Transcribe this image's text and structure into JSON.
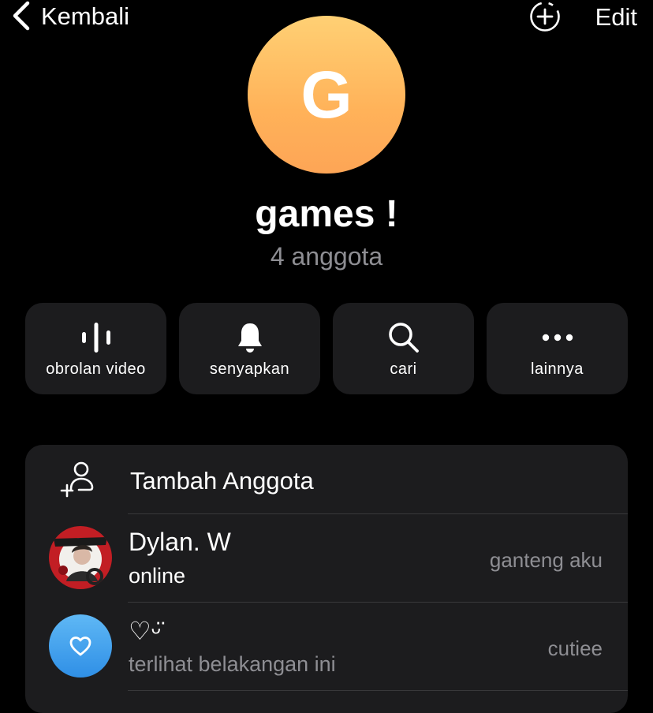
{
  "header": {
    "back_label": "Kembali",
    "edit_label": "Edit"
  },
  "group": {
    "avatar_letter": "G",
    "name": "games !",
    "member_count": "4 anggota"
  },
  "actions": [
    {
      "label": "obrolan video",
      "icon": "waveform-icon"
    },
    {
      "label": "senyapkan",
      "icon": "bell-icon"
    },
    {
      "label": "cari",
      "icon": "search-icon"
    },
    {
      "label": "lainnya",
      "icon": "more-icon"
    }
  ],
  "members_section": {
    "add_label": "Tambah Anggota",
    "members": [
      {
        "name": "Dylan. W",
        "status": "online",
        "title": "ganteng aku",
        "avatar": "photo"
      },
      {
        "name": "♡ᵕ̈",
        "status": "terlihat belakangan ini",
        "title": "cutiee",
        "avatar": "heart"
      }
    ]
  },
  "colors": {
    "background": "#000000",
    "card": "#1c1c1e",
    "secondary_text": "#8e8e93",
    "online": "#ffffff",
    "avatar_gradient_top": "#ffd074",
    "avatar_gradient_bottom": "#fda556",
    "heart_avatar": "#3a9ef0"
  }
}
